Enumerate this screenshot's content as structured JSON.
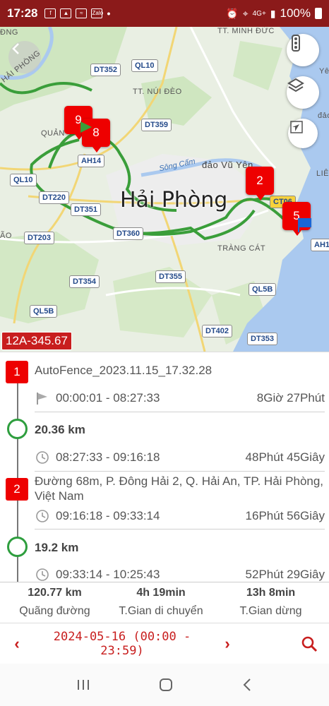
{
  "status_bar": {
    "time": "17:28",
    "network": "4G+",
    "battery": "100%",
    "app_icons": [
      "facebook-icon",
      "image-icon",
      "rss-icon",
      "zalo-icon",
      "dot-icon"
    ],
    "zalo_label": "Zalo"
  },
  "map": {
    "city_name": "Hải Phòng",
    "vehicle_plate": "12A-345.67",
    "road_labels": [
      "DT352",
      "QL10",
      "DT359",
      "AH14",
      "QL10",
      "DT220",
      "DT351",
      "DT203",
      "DT360",
      "DT355",
      "DT354",
      "QL5B",
      "QL5B",
      "DT402",
      "DT353",
      "CT06",
      "AH1"
    ],
    "place_labels": [
      "TT. MINH ĐỨC",
      "TT. NÚI ĐÈO",
      "QUẢN",
      "đảo Vũ Yên",
      "TRÀNG CÁT",
      "HẢI PHÒNG",
      "ĐNG",
      "ÃO",
      "Yê",
      "đảo",
      "LIÊ"
    ],
    "river_label": "Sông Cấm",
    "markers": [
      "9",
      "8",
      "2",
      "5"
    ],
    "route_color": "#3a9e3a",
    "marker_color": "#e00000"
  },
  "trip": {
    "stops": [
      {
        "number": "1",
        "title": "AutoFence_2023.11.15_17.32.28",
        "time_range": "00:00:01 - 08:27:33",
        "duration": "8Giờ 27Phút"
      },
      {
        "number": "2",
        "title": "Đường 68m, P. Đông Hải 2, Q. Hải An, TP. Hải Phòng, Việt Nam",
        "time_range": "09:16:18 - 09:33:14",
        "duration": "16Phút 56Giây"
      }
    ],
    "moves": [
      {
        "distance": "20.36 km",
        "time_range": "08:27:33 - 09:16:18",
        "duration": "48Phút 45Giây"
      },
      {
        "distance": "19.2 km",
        "time_range": "09:33:14 - 10:25:43",
        "duration": "52Phút 29Giây"
      }
    ]
  },
  "summary": {
    "distance_value": "120.77 km",
    "distance_label": "Quãng đường",
    "moving_value": "4h 19min",
    "moving_label": "T.Gian di chuyển",
    "stop_value": "13h 8min",
    "stop_label": "T.Gian dừng"
  },
  "date_bar": {
    "prev": "‹",
    "date": "2024-05-16 (00:00 - 23:59)",
    "next": "›"
  }
}
